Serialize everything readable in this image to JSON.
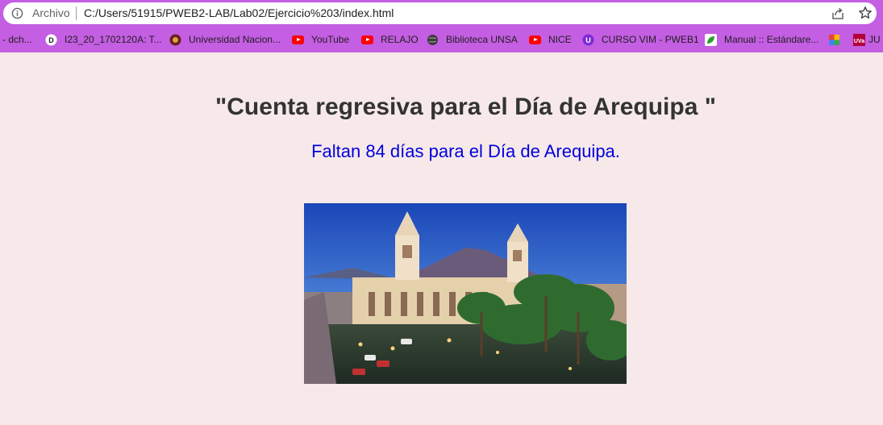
{
  "browser": {
    "security_label": "Archivo",
    "url": "C:/Users/51915/PWEB2-LAB/Lab02/Ejercicio%203/index.html"
  },
  "bookmarks": [
    {
      "label": "- dch...",
      "icon": "none"
    },
    {
      "label": "I23_20_1702120A: T...",
      "icon": "moodle-icon"
    },
    {
      "label": "Universidad Nacion...",
      "icon": "university-icon"
    },
    {
      "label": "YouTube",
      "icon": "youtube-icon"
    },
    {
      "label": "RELAJO",
      "icon": "youtube-icon"
    },
    {
      "label": "Biblioteca UNSA",
      "icon": "globe-icon"
    },
    {
      "label": "NICE",
      "icon": "youtube-icon"
    },
    {
      "label": "CURSO VIM - PWEB1",
      "icon": "purple-u-icon"
    },
    {
      "label": "Manual :: Estándare...",
      "icon": "leaf-icon"
    },
    {
      "label": "",
      "icon": "colorful-icon"
    },
    {
      "label": "JU",
      "icon": "uva-icon"
    }
  ],
  "page": {
    "title": "\"Cuenta regresiva para el Día de Arequipa \"",
    "countdown": "Faltan 84 días para el Día de Arequipa.",
    "image_alt": "Plaza de Armas de Arequipa"
  },
  "colors": {
    "browser_chrome": "#c45ee2",
    "page_background": "#f7e9e9",
    "title": "#333333",
    "countdown": "#0000dd"
  }
}
